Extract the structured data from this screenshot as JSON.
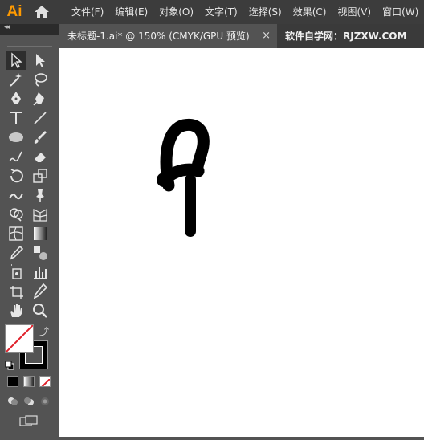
{
  "app": {
    "logo": "Ai"
  },
  "menu": [
    "文件(F)",
    "编辑(E)",
    "对象(O)",
    "文字(T)",
    "选择(S)",
    "效果(C)",
    "视图(V)",
    "窗口(W)"
  ],
  "document_tab": {
    "title": "未标题-1.ai* @ 150% (CMYK/GPU 预览)",
    "close": "×"
  },
  "second_tab": "软件自学网：RJZXW.COM",
  "panel": {
    "collapse": "◂◂"
  },
  "colors": {
    "menubar": "#3c3c3c",
    "panel": "#535353",
    "canvas": "#ffffff",
    "logo": "#ff9a00",
    "none_slash": "#e0202a"
  }
}
